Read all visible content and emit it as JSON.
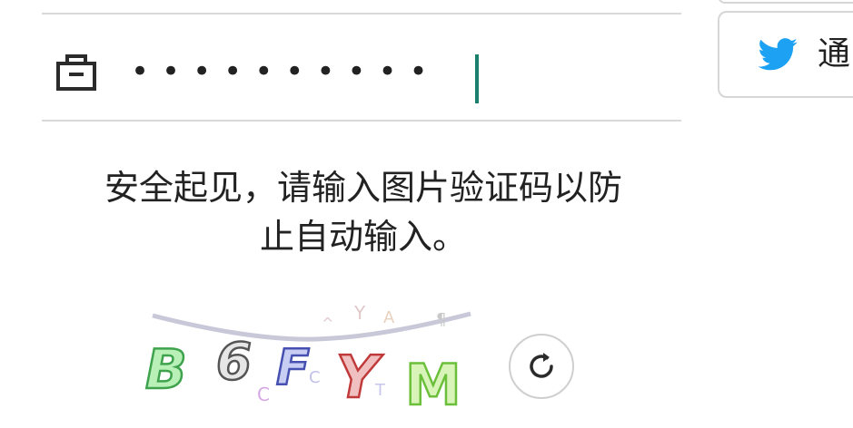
{
  "password": {
    "masked_value": "••••••••••"
  },
  "social_login": {
    "label": "通",
    "icon": "twitter-bird-icon",
    "icon_color": "#1da1f2"
  },
  "notice": {
    "line1": "安全起见，请输入图片验证码以防",
    "line2": "止自动输入。"
  },
  "captcha": {
    "characters": [
      "B",
      "6",
      "F",
      "Y",
      "M"
    ]
  },
  "colors": {
    "caret": "#1a7f6d",
    "text": "#222222",
    "divider": "#d9d9d9"
  },
  "icons": {
    "lock": "lock-icon",
    "refresh": "refresh-icon"
  }
}
